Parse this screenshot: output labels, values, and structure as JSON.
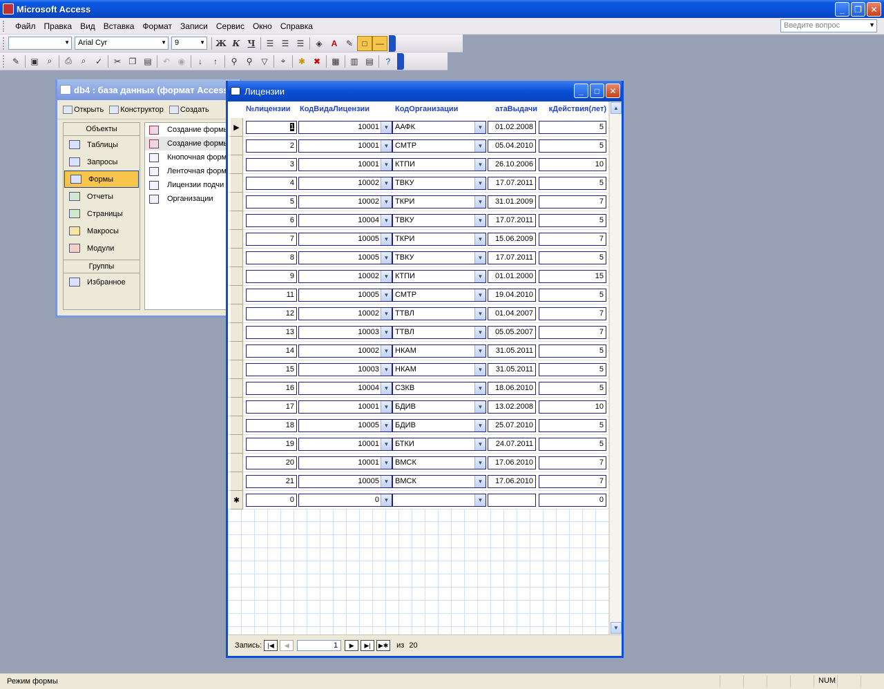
{
  "app": {
    "title": "Microsoft Access"
  },
  "menu": [
    "Файл",
    "Правка",
    "Вид",
    "Вставка",
    "Формат",
    "Записи",
    "Сервис",
    "Окно",
    "Справка"
  ],
  "ask_placeholder": "Введите вопрос",
  "toolbar": {
    "font_name": "Arial Cyr",
    "font_size": "9"
  },
  "dbwin": {
    "title": "db4 : база данных (формат Access",
    "tools": [
      "Открыть",
      "Конструктор",
      "Создать"
    ],
    "objects_header": "Объекты",
    "objects": [
      "Таблицы",
      "Запросы",
      "Формы",
      "Отчеты",
      "Страницы",
      "Макросы",
      "Модули"
    ],
    "groups_header": "Группы",
    "groups": [
      "Избранное"
    ],
    "forms": [
      "Создание формы",
      "Создание формы",
      "Кнопочная форм",
      "Ленточная форм",
      "Лицензии подчи",
      "Организации"
    ]
  },
  "form": {
    "title": "Лицензии",
    "columns": [
      "№лицензии",
      "КодВидаЛицензии",
      "КодОрганизации",
      "атаВыдачи",
      "кДействия(лет)"
    ],
    "rows": [
      [
        "1",
        "10001",
        "ААФК",
        "01.02.2008",
        "5"
      ],
      [
        "2",
        "10001",
        "СМТР",
        "05.04.2010",
        "5"
      ],
      [
        "3",
        "10001",
        "КТПИ",
        "26.10.2006",
        "10"
      ],
      [
        "4",
        "10002",
        "ТВКУ",
        "17.07.2011",
        "5"
      ],
      [
        "5",
        "10002",
        "ТКРИ",
        "31.01.2009",
        "7"
      ],
      [
        "6",
        "10004",
        "ТВКУ",
        "17.07.2011",
        "5"
      ],
      [
        "7",
        "10005",
        "ТКРИ",
        "15.06.2009",
        "7"
      ],
      [
        "8",
        "10005",
        "ТВКУ",
        "17.07.2011",
        "5"
      ],
      [
        "9",
        "10002",
        "КТПИ",
        "01.01.2000",
        "15"
      ],
      [
        "11",
        "10005",
        "СМТР",
        "19.04.2010",
        "5"
      ],
      [
        "12",
        "10002",
        "ТТВЛ",
        "01.04.2007",
        "7"
      ],
      [
        "13",
        "10003",
        "ТТВЛ",
        "05.05.2007",
        "7"
      ],
      [
        "14",
        "10002",
        "НКАМ",
        "31.05.2011",
        "5"
      ],
      [
        "15",
        "10003",
        "НКАМ",
        "31.05.2011",
        "5"
      ],
      [
        "16",
        "10004",
        "СЗКВ",
        "18.06.2010",
        "5"
      ],
      [
        "17",
        "10001",
        "БДИВ",
        "13.02.2008",
        "10"
      ],
      [
        "18",
        "10005",
        "БДИВ",
        "25.07.2010",
        "5"
      ],
      [
        "19",
        "10001",
        "БТКИ",
        "24.07.2011",
        "5"
      ],
      [
        "20",
        "10001",
        "ВМСК",
        "17.06.2010",
        "7"
      ],
      [
        "21",
        "10005",
        "ВМСК",
        "17.06.2010",
        "7"
      ]
    ],
    "new_row": [
      "0",
      "0",
      "",
      "",
      "0"
    ],
    "nav": {
      "label": "Запись:",
      "current": "1",
      "of": "из",
      "total": "20"
    }
  },
  "status": {
    "text": "Режим формы",
    "num": "NUM"
  }
}
